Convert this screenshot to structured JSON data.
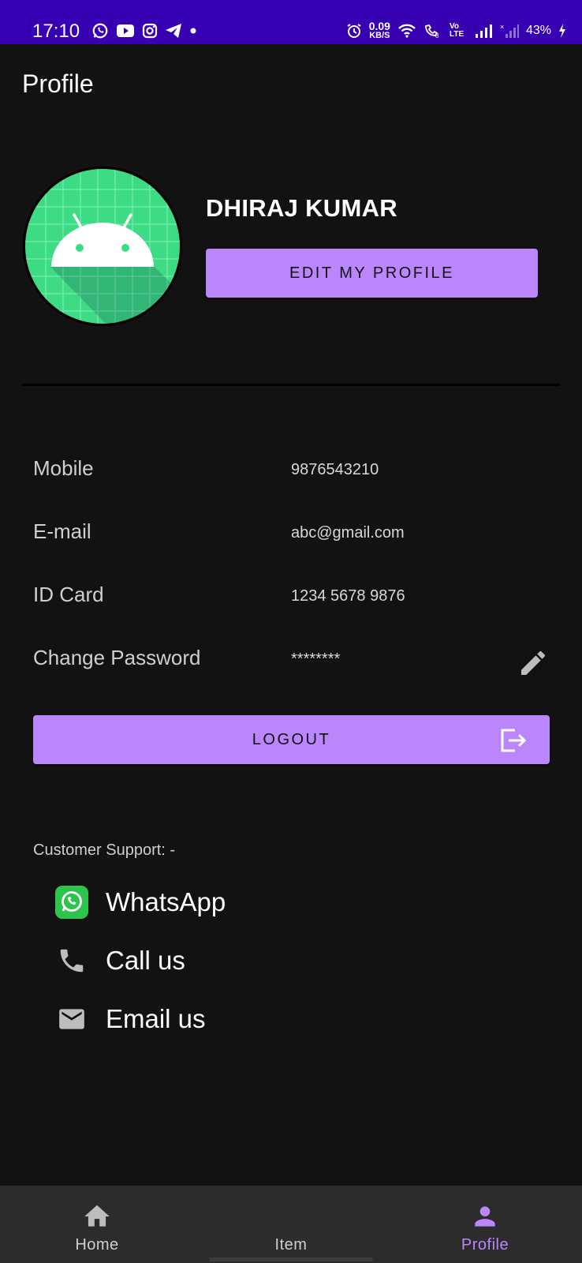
{
  "status_bar": {
    "time": "17:10",
    "net_speed_value": "0.09",
    "net_speed_unit": "KB/S",
    "volte": "Vo LTE",
    "battery": "43%"
  },
  "header": {
    "title": "Profile"
  },
  "profile": {
    "name": "DHIRAJ KUMAR",
    "edit_button": "EDIT MY PROFILE"
  },
  "info": {
    "mobile_label": "Mobile",
    "mobile_value": "9876543210",
    "email_label": "E-mail",
    "email_value": "abc@gmail.com",
    "id_label": "ID Card",
    "id_value": "1234 5678 9876",
    "password_label": "Change Password",
    "password_value": "********"
  },
  "logout_button": "LOGOUT",
  "support": {
    "label": "Customer Support: -",
    "items": [
      {
        "label": "WhatsApp",
        "icon": "whatsapp-icon"
      },
      {
        "label": "Call us",
        "icon": "phone-icon"
      },
      {
        "label": "Email us",
        "icon": "mail-icon"
      }
    ]
  },
  "nav": {
    "items": [
      {
        "label": "Home",
        "icon": "home-icon"
      },
      {
        "label": "Item",
        "icon": "none"
      },
      {
        "label": "Profile",
        "icon": "person-icon",
        "active": true
      }
    ]
  },
  "colors": {
    "accent": "#bb86fc",
    "status_bar": "#3700b3",
    "background": "#121212",
    "nav_background": "#2c2c2c",
    "avatar_green": "#3ddc84"
  }
}
